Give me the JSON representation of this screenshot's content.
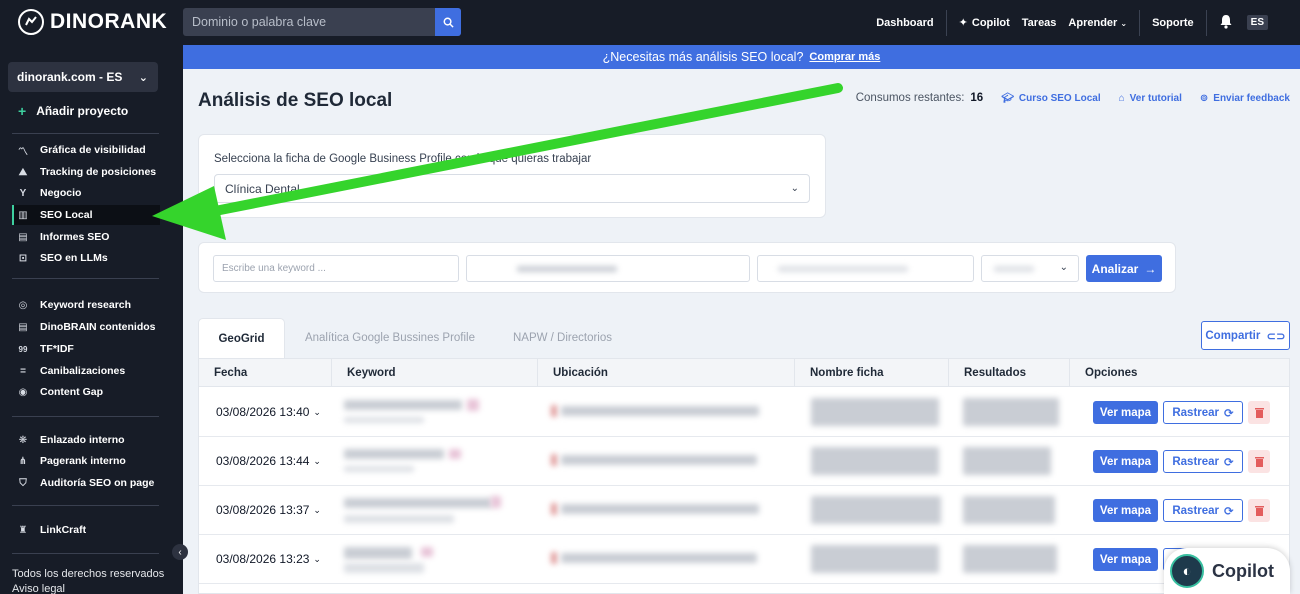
{
  "topbar": {
    "brand": "DINORANK",
    "search_placeholder": "Dominio o palabra clave",
    "nav": {
      "dashboard": "Dashboard",
      "copilot": "Copilot",
      "tareas": "Tareas",
      "aprender": "Aprender",
      "soporte": "Soporte",
      "lang": "ES"
    }
  },
  "sidebar": {
    "project": "dinorank.com - ES",
    "add_project": "Añadir proyecto",
    "group1": [
      {
        "label": "Gráfica de visibilidad",
        "icon": "chart-line-icon"
      },
      {
        "label": "Tracking de posiciones",
        "icon": "trend-icon"
      },
      {
        "label": "Negocio",
        "icon": "funnel-icon"
      },
      {
        "label": "SEO Local",
        "icon": "map-icon"
      },
      {
        "label": "Informes SEO",
        "icon": "report-icon"
      },
      {
        "label": "SEO en LLMs",
        "icon": "ai-chat-icon"
      }
    ],
    "group2": [
      {
        "label": "Keyword research",
        "icon": "target-icon"
      },
      {
        "label": "DinoBRAIN contenidos",
        "icon": "document-icon"
      },
      {
        "label": "TF*IDF",
        "icon": "tfidf-icon"
      },
      {
        "label": "Canibalizaciones",
        "icon": "equals-icon"
      },
      {
        "label": "Content Gap",
        "icon": "eye-icon"
      }
    ],
    "group3": [
      {
        "label": "Enlazado interno",
        "icon": "network-icon"
      },
      {
        "label": "Pagerank interno",
        "icon": "hierarchy-icon"
      },
      {
        "label": "Auditoría SEO on page",
        "icon": "shield-icon"
      }
    ],
    "group4": [
      {
        "label": "LinkCraft",
        "icon": "linkcraft-icon"
      }
    ],
    "footer": {
      "rights": "Todos los derechos reservados",
      "legal": "Aviso legal"
    }
  },
  "banner": {
    "text": "¿Necesitas más análisis SEO local?",
    "link": "Comprar más"
  },
  "main": {
    "title": "Análisis de SEO local",
    "consumos_label": "Consumos restantes:",
    "consumos_value": "16",
    "links": {
      "curso": "Curso SEO Local",
      "tutorial": "Ver tutorial",
      "feedback": "Enviar feedback"
    },
    "gbp": {
      "label": "Selecciona la ficha de Google Business Profile con la que quieras trabajar",
      "selected": "Clínica Dental"
    },
    "keyword": {
      "placeholder": "Escribe una keyword ...",
      "analyze": "Analizar"
    },
    "tabs": [
      "GeoGrid",
      "Analítica Google Bussines Profile",
      "NAPW / Directorios"
    ],
    "share": "Compartir",
    "table": {
      "headers": [
        "Fecha",
        "Keyword",
        "Ubicación",
        "Nombre ficha",
        "Resultados",
        "Opciones"
      ],
      "rows": [
        {
          "fecha": "03/08/2026 13:40"
        },
        {
          "fecha": "03/08/2026 13:44"
        },
        {
          "fecha": "03/08/2026 13:37"
        },
        {
          "fecha": "03/08/2026 13:23"
        }
      ],
      "btn_map": "Ver mapa",
      "btn_track": "Rastrear"
    }
  },
  "copilot_fab": "Copilot",
  "colors": {
    "accent": "#3f6ee0",
    "dark": "#171c27",
    "green": "#3ed09f"
  }
}
